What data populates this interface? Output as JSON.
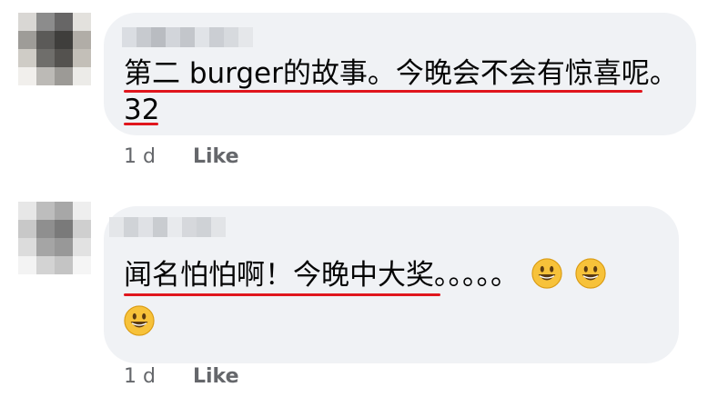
{
  "comments": [
    {
      "line1": "第二 burger的故事。今晚会不会有惊喜呢。",
      "line2": "32",
      "time": "1 d",
      "like_label": "Like"
    },
    {
      "line1": "闻名怕怕啊！今晚中大奖。。。。。",
      "line2": "",
      "emoji_count_line1": 2,
      "emoji_count_line2": 1,
      "time": "1 d",
      "like_label": "Like"
    }
  ],
  "colors": {
    "bubble": "#f0f2f5",
    "underline": "#e0161d",
    "meta_text": "#65676b",
    "emoji_face": "#f7c23a"
  },
  "icons": [
    "grinning-face-emoji"
  ]
}
